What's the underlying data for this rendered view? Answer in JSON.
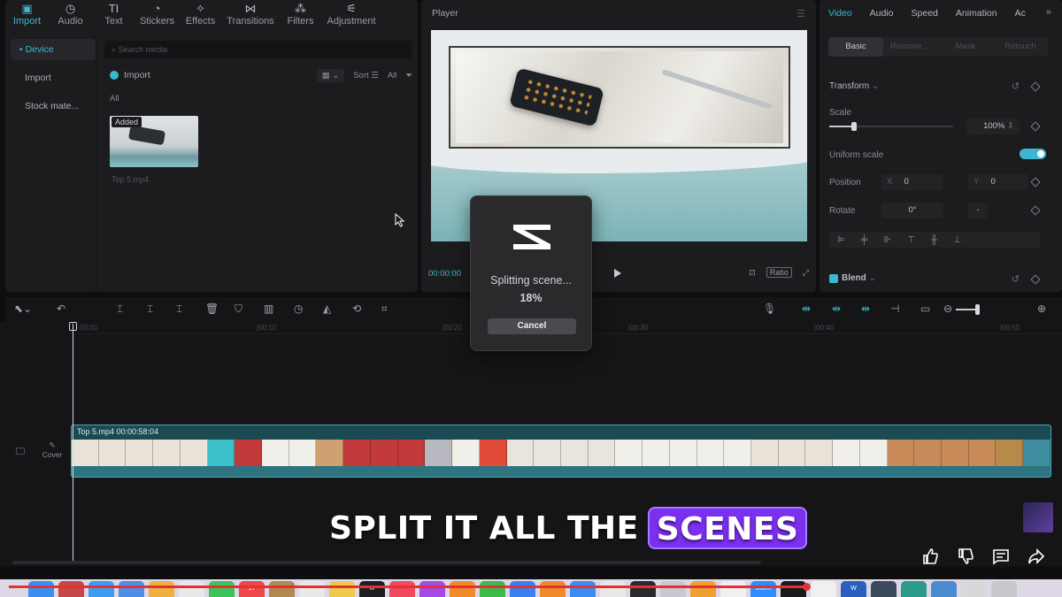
{
  "media": {
    "tabs": [
      {
        "label": "Import",
        "icon": "import-icon"
      },
      {
        "label": "Audio",
        "icon": "audio-icon"
      },
      {
        "label": "Text",
        "icon": "text-icon"
      },
      {
        "label": "Stickers",
        "icon": "stickers-icon"
      },
      {
        "label": "Effects",
        "icon": "effects-icon"
      },
      {
        "label": "Transitions",
        "icon": "transitions-icon"
      },
      {
        "label": "Filters",
        "icon": "filters-icon"
      },
      {
        "label": "Adjustment",
        "icon": "adjustment-icon"
      }
    ],
    "sidebar": [
      "• Device",
      "Import",
      "Stock mate..."
    ],
    "search_placeholder": "Search media",
    "import_label": "Import",
    "sort_label": "Sort",
    "all_filter": "All",
    "all_label": "All",
    "thumb_badge": "Added",
    "thumb_name": "Top 5.mp4"
  },
  "player": {
    "title": "Player",
    "time": "00:00:00",
    "ratio": "Ratio"
  },
  "properties": {
    "tabs": [
      "Video",
      "Audio",
      "Speed",
      "Animation",
      "Ac"
    ],
    "more": "»",
    "subtabs": [
      "Basic",
      "Remove ...",
      "Mask",
      "Retouch"
    ],
    "transform": "Transform",
    "scale_label": "Scale",
    "scale_value": "100%",
    "scale_fraction": 0.2,
    "uniform_scale": "Uniform scale",
    "position_label": "Position",
    "pos_x_label": "X",
    "pos_x": "0",
    "pos_y_label": "Y",
    "pos_y": "0",
    "rotate_label": "Rotate",
    "rotate_value": "0°",
    "rotate_extra": "-",
    "blend": "Blend"
  },
  "timeline": {
    "ruler": [
      "00:00",
      "|00:10",
      "|00:20",
      "|00:30",
      "|00:40",
      "|00:50"
    ],
    "cover": "Cover",
    "clip_title": "Top 5.mp4   00:00:58:04",
    "frame_colors": [
      "#e8e2d8",
      "#e8e2d8",
      "#e8e2d8",
      "#e8e2d8",
      "#e8e2d8",
      "#3cc0c8",
      "#c23a3a",
      "#f1efea",
      "#f1efea",
      "#d0a070",
      "#c23a3a",
      "#c23a3a",
      "#c23a3a",
      "#b8b8c0",
      "#f1efea",
      "#e24a3a",
      "#e9e4dc",
      "#e9e4dc",
      "#e9e4dc",
      "#e9e4dc",
      "#f1efea",
      "#f1efea",
      "#f1efea",
      "#f1efea",
      "#f1efea",
      "#e8e2d8",
      "#e8e2d8",
      "#e8e2d8",
      "#f1efea",
      "#f1efea",
      "#c98a5a",
      "#c98a5a",
      "#c98a5a",
      "#c98a5a",
      "#b88a4a",
      "#3e8ea0"
    ]
  },
  "dialog": {
    "message": "Splitting scene...",
    "percent": "18%",
    "cancel": "Cancel"
  },
  "caption": {
    "prefix": "SPLIT IT ALL THE",
    "highlight": "SCENES"
  },
  "video_progress": 0.77,
  "dock": {
    "icons": [
      {
        "name": "finder-icon",
        "color": "#3b8ff0"
      },
      {
        "name": "launchpad-icon",
        "color": "#c44848"
      },
      {
        "name": "safari-icon",
        "color": "#3c9cf0"
      },
      {
        "name": "mail-icon",
        "color": "#4c8ee8"
      },
      {
        "name": "photos-icon",
        "color": "#f0b040"
      },
      {
        "name": "reminders-icon",
        "color": "#e8e8e8"
      },
      {
        "name": "facetime-icon",
        "color": "#3cc45a"
      },
      {
        "name": "calendar-icon",
        "color": "#f04848",
        "label": "17"
      },
      {
        "name": "notes-icon",
        "color": "#b08850"
      },
      {
        "name": "contacts-icon",
        "color": "#e8e8e8"
      },
      {
        "name": "stickies-icon",
        "color": "#f0c84a"
      },
      {
        "name": "appletv-icon",
        "color": "#1e1e22",
        "label": "tv"
      },
      {
        "name": "music-icon",
        "color": "#f04a60"
      },
      {
        "name": "podcasts-icon",
        "color": "#a54ae8"
      },
      {
        "name": "books-icon",
        "color": "#f08a2a"
      },
      {
        "name": "numbers-icon",
        "color": "#3cba4a"
      },
      {
        "name": "keynote-icon",
        "color": "#3a80f0"
      },
      {
        "name": "pages-icon",
        "color": "#f08a2a"
      },
      {
        "name": "appstore-icon",
        "color": "#3a8cf0"
      },
      {
        "name": "chrome-icon",
        "color": "#e8e8e8"
      },
      {
        "name": "activity-icon",
        "color": "#2a2a2e"
      },
      {
        "name": "preview-icon",
        "color": "#c8c8d0"
      },
      {
        "name": "vlc-icon",
        "color": "#f0a030"
      },
      {
        "name": "app-icon",
        "color": "#f0f0f0"
      },
      {
        "name": "zoom-icon",
        "color": "#2d8cff",
        "label": "zoom"
      },
      {
        "name": "capcut-icon",
        "color": "#1a1a1e"
      },
      {
        "name": "notion-icon",
        "color": "#f0f0f0"
      },
      {
        "name": "word-icon",
        "color": "#2b5fbf",
        "label": "W"
      },
      {
        "name": "app2-icon",
        "color": "#3a4a5a"
      },
      {
        "name": "app3-icon",
        "color": "#2a9a8a"
      },
      {
        "name": "folder-icon",
        "color": "#4a8ad0"
      },
      {
        "name": "screenshot-icon",
        "color": "#d8d8d8"
      },
      {
        "name": "trash-icon",
        "color": "#c8c8cc"
      }
    ]
  }
}
